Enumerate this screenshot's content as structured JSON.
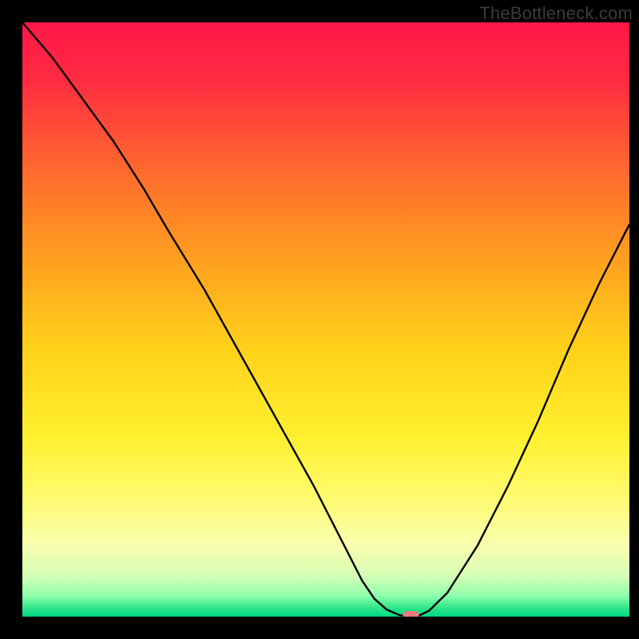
{
  "watermark": "TheBottleneck.com",
  "chart_data": {
    "type": "line",
    "title": "",
    "xlabel": "",
    "ylabel": "",
    "xlim": [
      0,
      100
    ],
    "ylim": [
      0,
      100
    ],
    "grid": false,
    "series": [
      {
        "name": "bottleneck-curve",
        "x": [
          0,
          5,
          10,
          15,
          20,
          24,
          30,
          36,
          42,
          48,
          53,
          56,
          58,
          60,
          62,
          63.5,
          65,
          67,
          70,
          75,
          80,
          85,
          90,
          95,
          100
        ],
        "y": [
          100,
          94,
          87,
          80,
          72,
          65,
          55,
          44,
          33,
          22,
          12,
          6,
          3,
          1.2,
          0.3,
          0.0,
          0.0,
          1.0,
          4,
          12,
          22,
          33,
          45,
          56,
          66
        ]
      }
    ],
    "marker": {
      "x": 64,
      "y": 0.2
    },
    "gradient_stops": [
      {
        "offset": 0.0,
        "color": "#ff1747"
      },
      {
        "offset": 0.1,
        "color": "#ff2c41"
      },
      {
        "offset": 0.25,
        "color": "#ff6a2e"
      },
      {
        "offset": 0.4,
        "color": "#ffa01f"
      },
      {
        "offset": 0.55,
        "color": "#ffd21a"
      },
      {
        "offset": 0.7,
        "color": "#fff030"
      },
      {
        "offset": 0.8,
        "color": "#fffb70"
      },
      {
        "offset": 0.88,
        "color": "#f8ffb0"
      },
      {
        "offset": 0.93,
        "color": "#d7ffb4"
      },
      {
        "offset": 0.965,
        "color": "#8fffad"
      },
      {
        "offset": 0.985,
        "color": "#30e58a"
      },
      {
        "offset": 1.0,
        "color": "#00d883"
      }
    ],
    "line_color": "#000000",
    "marker_color": "#ef7a7f"
  }
}
